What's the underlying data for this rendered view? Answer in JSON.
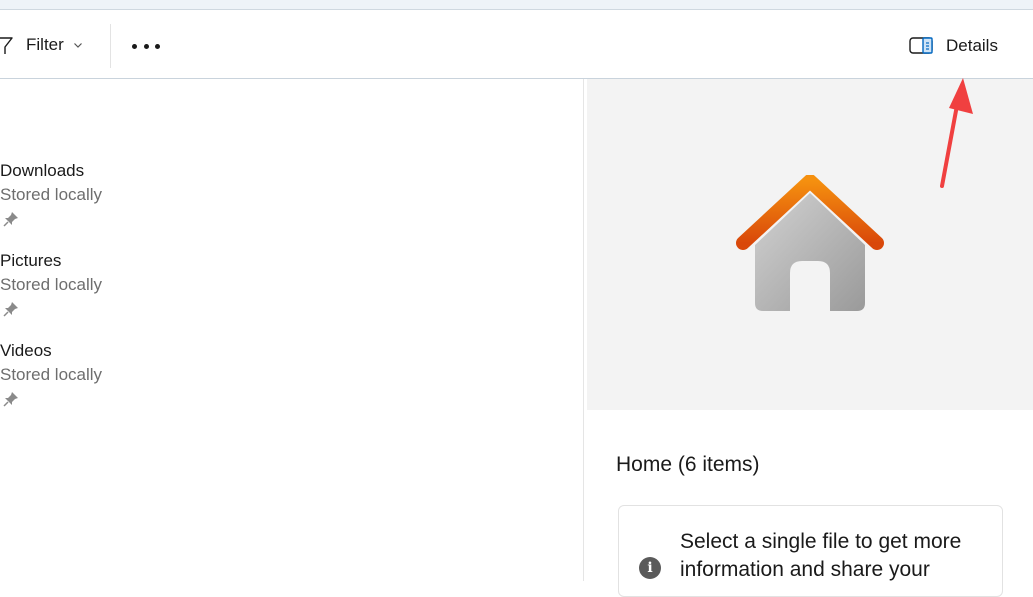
{
  "toolbar": {
    "filter_label": "Filter",
    "more_icon": "more-horizontal-icon",
    "details_label": "Details",
    "details_icon": "details-pane-icon"
  },
  "items": [
    {
      "name": "Downloads",
      "status": "Stored locally",
      "pin_icon": "pin-icon"
    },
    {
      "name": "Pictures",
      "status": "Stored locally",
      "pin_icon": "pin-icon"
    },
    {
      "name": "Videos",
      "status": "Stored locally",
      "pin_icon": "pin-icon"
    }
  ],
  "details_pane": {
    "preview_icon": "home-icon",
    "title": "Home (6 items)",
    "info_text": "Select a single file to get more information and share your",
    "info_icon": "info-icon"
  },
  "annotation": {
    "arrow_color": "#f04040"
  },
  "colors": {
    "accent": "#0067c0",
    "house_roof": "#e8650a",
    "house_body": "#b0b0b0"
  }
}
